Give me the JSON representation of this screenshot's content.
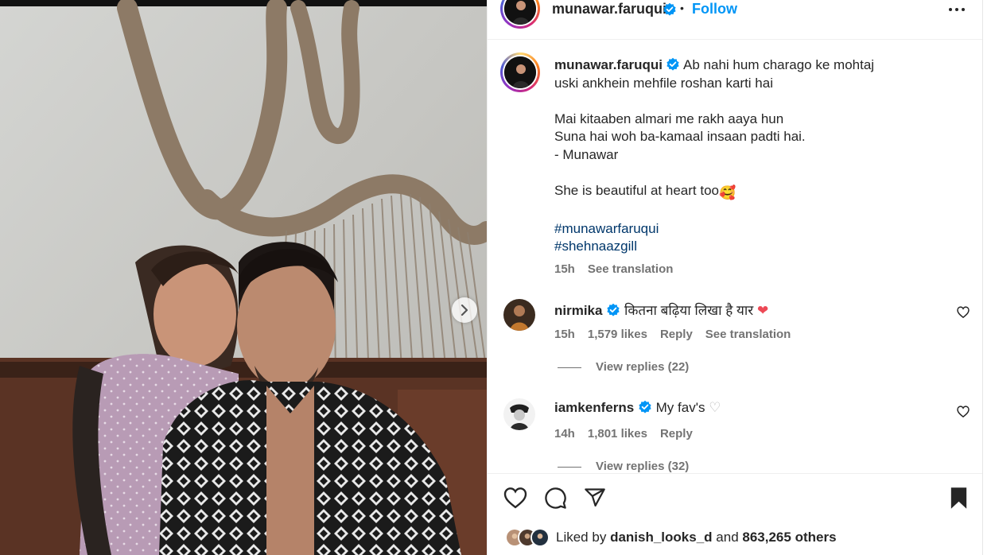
{
  "post": {
    "username": "munawar.faruqui",
    "dot": "•",
    "follow_label": "Follow",
    "more_icon": "more-horizontal-icon"
  },
  "caption": {
    "username": "munawar.faruqui",
    "lines": [
      "Ab nahi hum charago ke mohtaj",
      "uski ankhein mehfile roshan karti hai",
      "",
      "Mai kitaaben almari me rakh aaya hun",
      "Suna hai woh ba-kamaal insaan padti hai.",
      "- Munawar",
      "",
      "She is beautiful at heart too"
    ],
    "emoji": "🥰",
    "hashtags": [
      "#munawarfaruqui",
      "#shehnaazgill"
    ],
    "time": "15h",
    "see_translation": "See translation"
  },
  "comments": [
    {
      "username": "nirmika",
      "text": "कितना बढ़िया लिखा है यार",
      "emoji": "❤",
      "time": "15h",
      "likes": "1,579 likes",
      "reply": "Reply",
      "see_translation": "See translation",
      "view_replies": "View replies (22)"
    },
    {
      "username": "iamkenferns",
      "text": "My fav's",
      "emoji": "♡",
      "time": "14h",
      "likes": "1,801 likes",
      "reply": "Reply",
      "view_replies": "View replies (32)"
    }
  ],
  "likes": {
    "prefix": "Liked by",
    "user": "danish_looks_d",
    "middle": "and",
    "count": "863,265 others"
  },
  "colors": {
    "link_blue": "#0095f6",
    "hashtag": "#00376b",
    "verified": "#0095f6",
    "heart_red": "#ed4956",
    "muted": "#737373"
  }
}
